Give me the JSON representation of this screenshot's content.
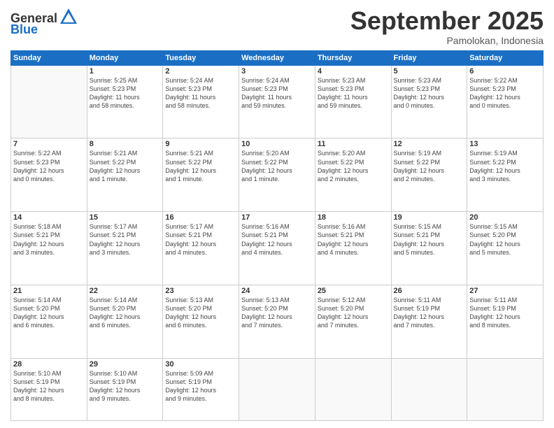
{
  "header": {
    "logo_general": "General",
    "logo_blue": "Blue",
    "month": "September 2025",
    "location": "Pamolokan, Indonesia"
  },
  "days_of_week": [
    "Sunday",
    "Monday",
    "Tuesday",
    "Wednesday",
    "Thursday",
    "Friday",
    "Saturday"
  ],
  "weeks": [
    [
      {
        "day": "",
        "lines": []
      },
      {
        "day": "1",
        "lines": [
          "Sunrise: 5:25 AM",
          "Sunset: 5:23 PM",
          "Daylight: 11 hours",
          "and 58 minutes."
        ]
      },
      {
        "day": "2",
        "lines": [
          "Sunrise: 5:24 AM",
          "Sunset: 5:23 PM",
          "Daylight: 11 hours",
          "and 58 minutes."
        ]
      },
      {
        "day": "3",
        "lines": [
          "Sunrise: 5:24 AM",
          "Sunset: 5:23 PM",
          "Daylight: 11 hours",
          "and 59 minutes."
        ]
      },
      {
        "day": "4",
        "lines": [
          "Sunrise: 5:23 AM",
          "Sunset: 5:23 PM",
          "Daylight: 11 hours",
          "and 59 minutes."
        ]
      },
      {
        "day": "5",
        "lines": [
          "Sunrise: 5:23 AM",
          "Sunset: 5:23 PM",
          "Daylight: 12 hours",
          "and 0 minutes."
        ]
      },
      {
        "day": "6",
        "lines": [
          "Sunrise: 5:22 AM",
          "Sunset: 5:23 PM",
          "Daylight: 12 hours",
          "and 0 minutes."
        ]
      }
    ],
    [
      {
        "day": "7",
        "lines": [
          "Sunrise: 5:22 AM",
          "Sunset: 5:23 PM",
          "Daylight: 12 hours",
          "and 0 minutes."
        ]
      },
      {
        "day": "8",
        "lines": [
          "Sunrise: 5:21 AM",
          "Sunset: 5:22 PM",
          "Daylight: 12 hours",
          "and 1 minute."
        ]
      },
      {
        "day": "9",
        "lines": [
          "Sunrise: 5:21 AM",
          "Sunset: 5:22 PM",
          "Daylight: 12 hours",
          "and 1 minute."
        ]
      },
      {
        "day": "10",
        "lines": [
          "Sunrise: 5:20 AM",
          "Sunset: 5:22 PM",
          "Daylight: 12 hours",
          "and 1 minute."
        ]
      },
      {
        "day": "11",
        "lines": [
          "Sunrise: 5:20 AM",
          "Sunset: 5:22 PM",
          "Daylight: 12 hours",
          "and 2 minutes."
        ]
      },
      {
        "day": "12",
        "lines": [
          "Sunrise: 5:19 AM",
          "Sunset: 5:22 PM",
          "Daylight: 12 hours",
          "and 2 minutes."
        ]
      },
      {
        "day": "13",
        "lines": [
          "Sunrise: 5:19 AM",
          "Sunset: 5:22 PM",
          "Daylight: 12 hours",
          "and 3 minutes."
        ]
      }
    ],
    [
      {
        "day": "14",
        "lines": [
          "Sunrise: 5:18 AM",
          "Sunset: 5:21 PM",
          "Daylight: 12 hours",
          "and 3 minutes."
        ]
      },
      {
        "day": "15",
        "lines": [
          "Sunrise: 5:17 AM",
          "Sunset: 5:21 PM",
          "Daylight: 12 hours",
          "and 3 minutes."
        ]
      },
      {
        "day": "16",
        "lines": [
          "Sunrise: 5:17 AM",
          "Sunset: 5:21 PM",
          "Daylight: 12 hours",
          "and 4 minutes."
        ]
      },
      {
        "day": "17",
        "lines": [
          "Sunrise: 5:16 AM",
          "Sunset: 5:21 PM",
          "Daylight: 12 hours",
          "and 4 minutes."
        ]
      },
      {
        "day": "18",
        "lines": [
          "Sunrise: 5:16 AM",
          "Sunset: 5:21 PM",
          "Daylight: 12 hours",
          "and 4 minutes."
        ]
      },
      {
        "day": "19",
        "lines": [
          "Sunrise: 5:15 AM",
          "Sunset: 5:21 PM",
          "Daylight: 12 hours",
          "and 5 minutes."
        ]
      },
      {
        "day": "20",
        "lines": [
          "Sunrise: 5:15 AM",
          "Sunset: 5:20 PM",
          "Daylight: 12 hours",
          "and 5 minutes."
        ]
      }
    ],
    [
      {
        "day": "21",
        "lines": [
          "Sunrise: 5:14 AM",
          "Sunset: 5:20 PM",
          "Daylight: 12 hours",
          "and 6 minutes."
        ]
      },
      {
        "day": "22",
        "lines": [
          "Sunrise: 5:14 AM",
          "Sunset: 5:20 PM",
          "Daylight: 12 hours",
          "and 6 minutes."
        ]
      },
      {
        "day": "23",
        "lines": [
          "Sunrise: 5:13 AM",
          "Sunset: 5:20 PM",
          "Daylight: 12 hours",
          "and 6 minutes."
        ]
      },
      {
        "day": "24",
        "lines": [
          "Sunrise: 5:13 AM",
          "Sunset: 5:20 PM",
          "Daylight: 12 hours",
          "and 7 minutes."
        ]
      },
      {
        "day": "25",
        "lines": [
          "Sunrise: 5:12 AM",
          "Sunset: 5:20 PM",
          "Daylight: 12 hours",
          "and 7 minutes."
        ]
      },
      {
        "day": "26",
        "lines": [
          "Sunrise: 5:11 AM",
          "Sunset: 5:19 PM",
          "Daylight: 12 hours",
          "and 7 minutes."
        ]
      },
      {
        "day": "27",
        "lines": [
          "Sunrise: 5:11 AM",
          "Sunset: 5:19 PM",
          "Daylight: 12 hours",
          "and 8 minutes."
        ]
      }
    ],
    [
      {
        "day": "28",
        "lines": [
          "Sunrise: 5:10 AM",
          "Sunset: 5:19 PM",
          "Daylight: 12 hours",
          "and 8 minutes."
        ]
      },
      {
        "day": "29",
        "lines": [
          "Sunrise: 5:10 AM",
          "Sunset: 5:19 PM",
          "Daylight: 12 hours",
          "and 9 minutes."
        ]
      },
      {
        "day": "30",
        "lines": [
          "Sunrise: 5:09 AM",
          "Sunset: 5:19 PM",
          "Daylight: 12 hours",
          "and 9 minutes."
        ]
      },
      {
        "day": "",
        "lines": []
      },
      {
        "day": "",
        "lines": []
      },
      {
        "day": "",
        "lines": []
      },
      {
        "day": "",
        "lines": []
      }
    ]
  ]
}
